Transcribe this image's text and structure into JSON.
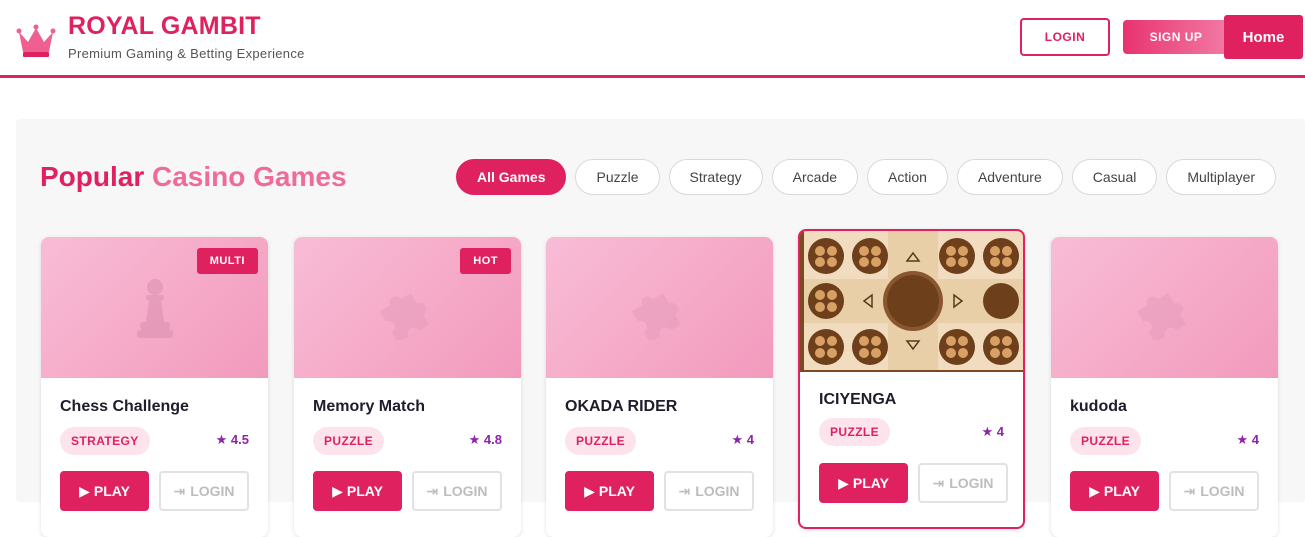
{
  "header": {
    "brand_title": "ROYAL GAMBIT",
    "brand_subtitle": "Premium Gaming & Betting Experience",
    "login_label": "LOGIN",
    "signup_label": "SIGN UP",
    "home_label": "Home",
    "accent_color": "#e0215f"
  },
  "section": {
    "title_part1": "Popular",
    "title_part2": "Casino",
    "title_part3": "Games",
    "filters": [
      "All Games",
      "Puzzle",
      "Strategy",
      "Arcade",
      "Action",
      "Adventure",
      "Casual",
      "Multiplayer"
    ],
    "active_filter": "All Games"
  },
  "games": [
    {
      "title": "Chess Challenge",
      "category": "STRATEGY",
      "rating": "★ 4.5",
      "badge": "MULTI",
      "icon": "chess-pawn-icon",
      "play_label": "PLAY",
      "login_label": "LOGIN"
    },
    {
      "title": "Memory Match",
      "category": "PUZZLE",
      "rating": "★ 4.8",
      "badge": "HOT",
      "icon": "puzzle-piece-icon",
      "play_label": "PLAY",
      "login_label": "LOGIN"
    },
    {
      "title": "OKADA RIDER",
      "category": "PUZZLE",
      "rating": "★ 4",
      "badge": "",
      "icon": "puzzle-piece-icon",
      "play_label": "PLAY",
      "login_label": "LOGIN"
    },
    {
      "title": "ICIYENGA",
      "category": "PUZZLE",
      "rating": "★ 4",
      "badge": "",
      "icon": "board-game-image",
      "play_label": "PLAY",
      "login_label": "LOGIN"
    },
    {
      "title": "kudoda",
      "category": "PUZZLE",
      "rating": "★ 4",
      "badge": "",
      "icon": "puzzle-piece-icon",
      "play_label": "PLAY",
      "login_label": "LOGIN"
    }
  ]
}
